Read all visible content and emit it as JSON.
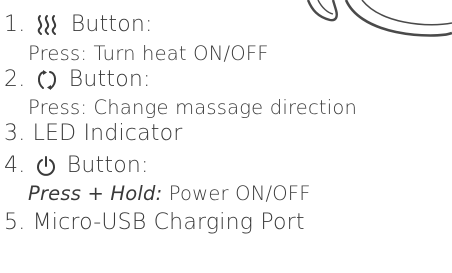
{
  "items": [
    {
      "number": "1.",
      "icon": "heat-icon",
      "label": "Button:",
      "detail_action": "",
      "detail_text": "Press: Turn heat ON/OFF"
    },
    {
      "number": "2.",
      "icon": "direction-arrows-icon",
      "label": "Button:",
      "detail_action": "",
      "detail_text": "Press: Change massage direction"
    },
    {
      "number": "3.",
      "icon": "",
      "label": "LED Indicator"
    },
    {
      "number": "4.",
      "icon": "power-icon",
      "label": "Button:",
      "detail_action": "Press + Hold:",
      "detail_text": " Power ON/OFF"
    },
    {
      "number": "5.",
      "icon": "",
      "label": "Micro-USB Charging Port"
    }
  ],
  "colors": {
    "text": "#3a3a3a",
    "illustration_line": "#4a4a4a"
  }
}
